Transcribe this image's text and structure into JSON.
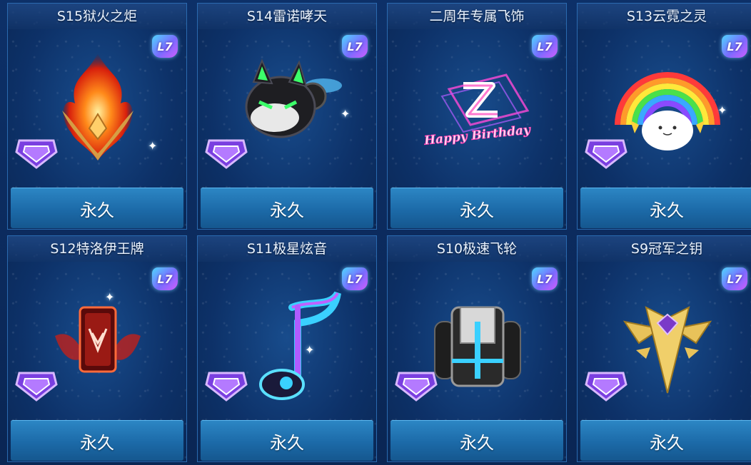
{
  "cards": [
    {
      "title": "S15狱火之炬",
      "level": "L7",
      "button": "永久",
      "art": "fire-torch-icon"
    },
    {
      "title": "S14雷诺哮天",
      "level": "L7",
      "button": "永久",
      "art": "black-dog-icon"
    },
    {
      "title": "二周年专属飞饰",
      "level": "L7",
      "button": "永久",
      "art": "birthday-logo-icon",
      "art_text": "Happy Birthday"
    },
    {
      "title": "S13云霓之灵",
      "level": "L7",
      "button": "永久",
      "art": "rainbow-cloud-icon"
    },
    {
      "title": "S12特洛伊王牌",
      "level": "L7",
      "button": "永久",
      "art": "red-card-icon"
    },
    {
      "title": "S11极星炫音",
      "level": "L7",
      "button": "永久",
      "art": "music-note-icon"
    },
    {
      "title": "S10极速飞轮",
      "level": "L7",
      "button": "永久",
      "art": "tire-wheel-icon"
    },
    {
      "title": "S9冠军之钥",
      "level": "L7",
      "button": "永久",
      "art": "golden-key-icon"
    }
  ],
  "colors": {
    "background": "#0b2a5a",
    "button": "#1c6aa8",
    "title_text": "#eaf3ff",
    "rank_purple": "#9a5cff"
  }
}
